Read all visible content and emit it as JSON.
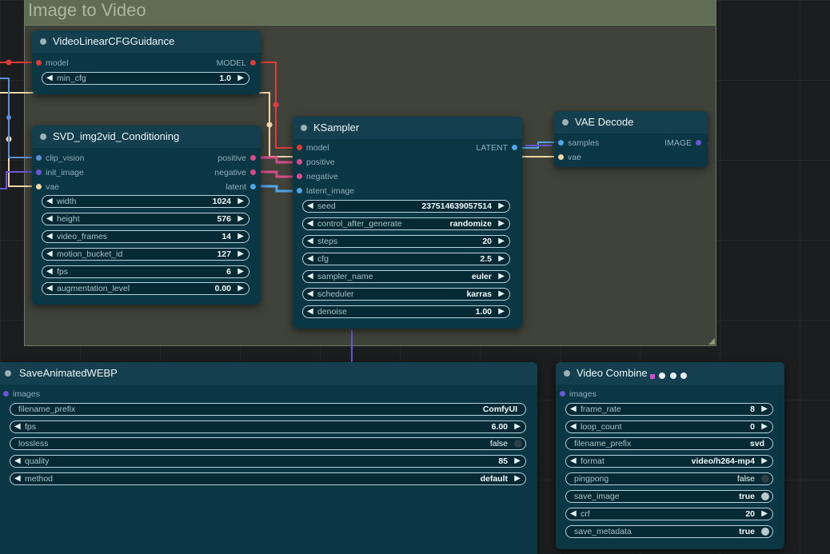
{
  "group": {
    "title": "Image to Video"
  },
  "colors": {
    "model": "#e03a3a",
    "conditioning": "#d64b8b",
    "latent": "#4fa6e6",
    "image": "#6b55d8",
    "clip_vision": "#5b8fd6",
    "vae": "#f3d7a6",
    "node_bg": "#0b3644",
    "group_bg": "#3f433a"
  },
  "nodes": {
    "cfg_guidance": {
      "title": "VideoLinearCFGGuidance",
      "input_model": "model",
      "output_model": "MODEL",
      "min_cfg": {
        "label": "min_cfg",
        "value": "1.0"
      }
    },
    "conditioning": {
      "title": "SVD_img2vid_Conditioning",
      "inputs": [
        "clip_vision",
        "init_image",
        "vae"
      ],
      "outputs": [
        "positive",
        "negative",
        "latent"
      ],
      "widgets": [
        {
          "label": "width",
          "value": "1024"
        },
        {
          "label": "height",
          "value": "576"
        },
        {
          "label": "video_frames",
          "value": "14"
        },
        {
          "label": "motion_bucket_id",
          "value": "127"
        },
        {
          "label": "fps",
          "value": "6"
        },
        {
          "label": "augmentation_level",
          "value": "0.00"
        }
      ]
    },
    "ksampler": {
      "title": "KSampler",
      "inputs": [
        "model",
        "positive",
        "negative",
        "latent_image"
      ],
      "output": "LATENT",
      "widgets": [
        {
          "label": "seed",
          "value": "237514639057514"
        },
        {
          "label": "control_after_generate",
          "value": "randomize"
        },
        {
          "label": "steps",
          "value": "20"
        },
        {
          "label": "cfg",
          "value": "2.5"
        },
        {
          "label": "sampler_name",
          "value": "euler"
        },
        {
          "label": "scheduler",
          "value": "karras"
        },
        {
          "label": "denoise",
          "value": "1.00"
        }
      ]
    },
    "vae_decode": {
      "title": "VAE Decode",
      "inputs": [
        "samples",
        "vae"
      ],
      "output": "IMAGE"
    },
    "save_webp": {
      "title": "SaveAnimatedWEBP",
      "input": "images",
      "filename_prefix": {
        "label": "filename_prefix",
        "value": "ComfyUI"
      },
      "fps": {
        "label": "fps",
        "value": "6.00"
      },
      "lossless": {
        "label": "lossless",
        "value": "false"
      },
      "quality": {
        "label": "quality",
        "value": "85"
      },
      "method": {
        "label": "method",
        "value": "default"
      }
    },
    "video_combine": {
      "title": "Video Combine",
      "badge_colors": [
        "#d64bd6",
        "#e6eef0",
        "#e6eef0",
        "#e6eef0"
      ],
      "input": "images",
      "frame_rate": {
        "label": "frame_rate",
        "value": "8"
      },
      "loop_count": {
        "label": "loop_count",
        "value": "0"
      },
      "filename_prefix": {
        "label": "filename_prefix",
        "value": "svd"
      },
      "format": {
        "label": "format",
        "value": "video/h264-mp4"
      },
      "pingpong": {
        "label": "pingpong",
        "value": "false"
      },
      "save_image": {
        "label": "save_image",
        "value": "true"
      },
      "crf": {
        "label": "crf",
        "value": "20"
      },
      "save_metadata": {
        "label": "save_metadata",
        "value": "true"
      }
    }
  }
}
